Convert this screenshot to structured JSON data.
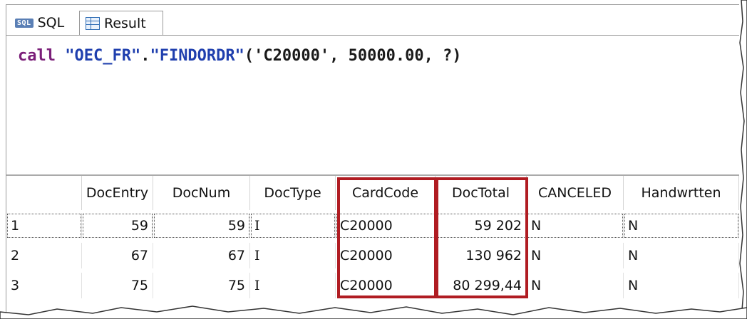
{
  "tabs": [
    {
      "icon": "sql-icon",
      "badge": "SQL",
      "label": "SQL"
    },
    {
      "icon": "result-grid-icon",
      "label": "Result"
    }
  ],
  "editor": {
    "keyword": "call",
    "schema": "\"OEC_FR\"",
    "dot": ".",
    "procedure": "\"FINDORDR\"",
    "args": "('C20000', 50000.00, ?)"
  },
  "table": {
    "columns": [
      "",
      "DocEntry",
      "DocNum",
      "DocType",
      "CardCode",
      "DocTotal",
      "CANCELED",
      "Handwrtten"
    ],
    "rows": [
      [
        "1",
        "59",
        "59",
        "I",
        "C20000",
        "59 202",
        "N",
        "N"
      ],
      [
        "2",
        "67",
        "67",
        "I",
        "C20000",
        "130 962",
        "N",
        "N"
      ],
      [
        "3",
        "75",
        "75",
        "I",
        "C20000",
        "80 299,44",
        "N",
        "N"
      ]
    ]
  },
  "colors": {
    "highlight_box": "#b01c22",
    "keyword": "#7b1f79",
    "string": "#1f3fae"
  }
}
